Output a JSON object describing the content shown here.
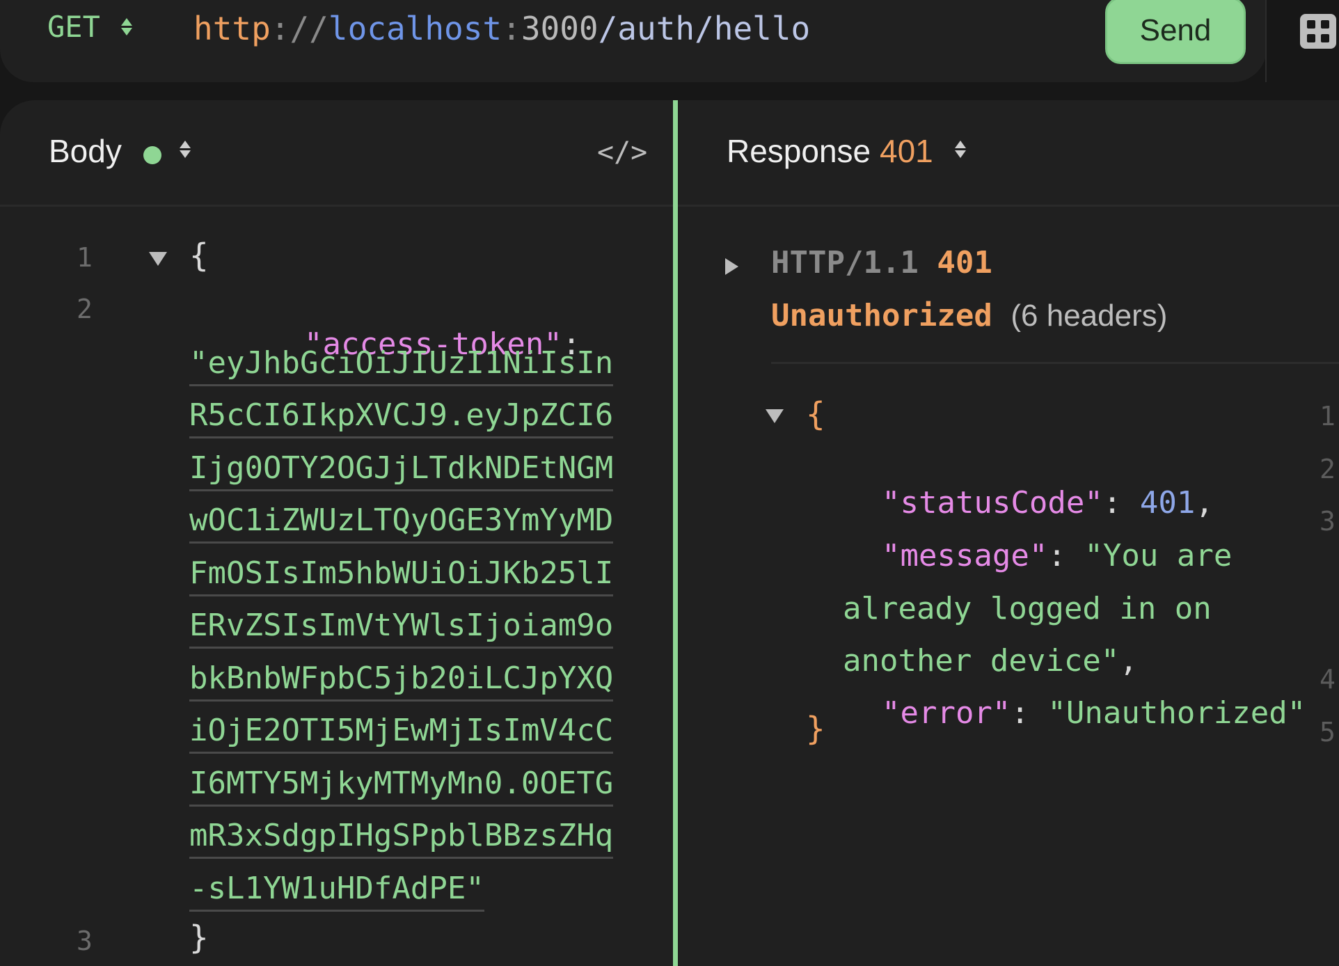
{
  "request": {
    "method": "GET",
    "url": {
      "scheme": "http",
      "sep1": "://",
      "host": "localhost",
      "sep2": ":",
      "port": "3000",
      "path": "/auth/hello"
    },
    "send_label": "Send"
  },
  "body_panel": {
    "title": "Body",
    "line_numbers": [
      "1",
      "2",
      "3"
    ],
    "open_brace": "{",
    "close_brace": "}",
    "key": "\"access-token\"",
    "colon": ":",
    "token_lines": [
      "\"eyJhbGciOiJIUzI1NiIsIn",
      "R5cCI6IkpXVCJ9.eyJpZCI6",
      "Ijg0OTY2OGJjLTdkNDEtNGM",
      "wOC1iZWUzLTQyOGE3YmYyMD",
      "FmOSIsIm5hbWUiOiJKb25lI",
      "ERvZSIsImVtYWlsIjoiam9o",
      "bkBnbWFpbC5jb20iLCJpYXQ",
      "iOjE2OTI5MjEwMjIsImV4cC",
      "I6MTY5MjkyMTMyMn0.0OETG",
      "mR3xSdgpIHgSPpblBBzsZHq",
      "-sL1YW1uHDfAdPE\""
    ]
  },
  "response_panel": {
    "title": "Response",
    "status_code": "401",
    "http_version": "HTTP/1.1",
    "status_text": "Unauthorized",
    "headers_count": "(6 headers)",
    "open_brace": "{",
    "close_brace": "}",
    "line_numbers": [
      "1",
      "2",
      "3",
      "4",
      "5"
    ],
    "fields": {
      "status_key": "\"statusCode\"",
      "status_value": "401",
      "message_key": "\"message\"",
      "message_value_1": "\"You are",
      "message_value_2": "already logged in on",
      "message_value_3": "another device\"",
      "error_key": "\"error\"",
      "error_value": "\"Unauthorized\""
    }
  },
  "colors": {
    "accent_green": "#8fd694",
    "orange": "#f0a060",
    "key_pink": "#e58ae6",
    "number_blue": "#8ea7e8"
  },
  "icons": [
    "sort-arrows-icon",
    "code-view-icon",
    "grid-icon",
    "expand-triangle-icon",
    "collapse-triangle-icon"
  ]
}
